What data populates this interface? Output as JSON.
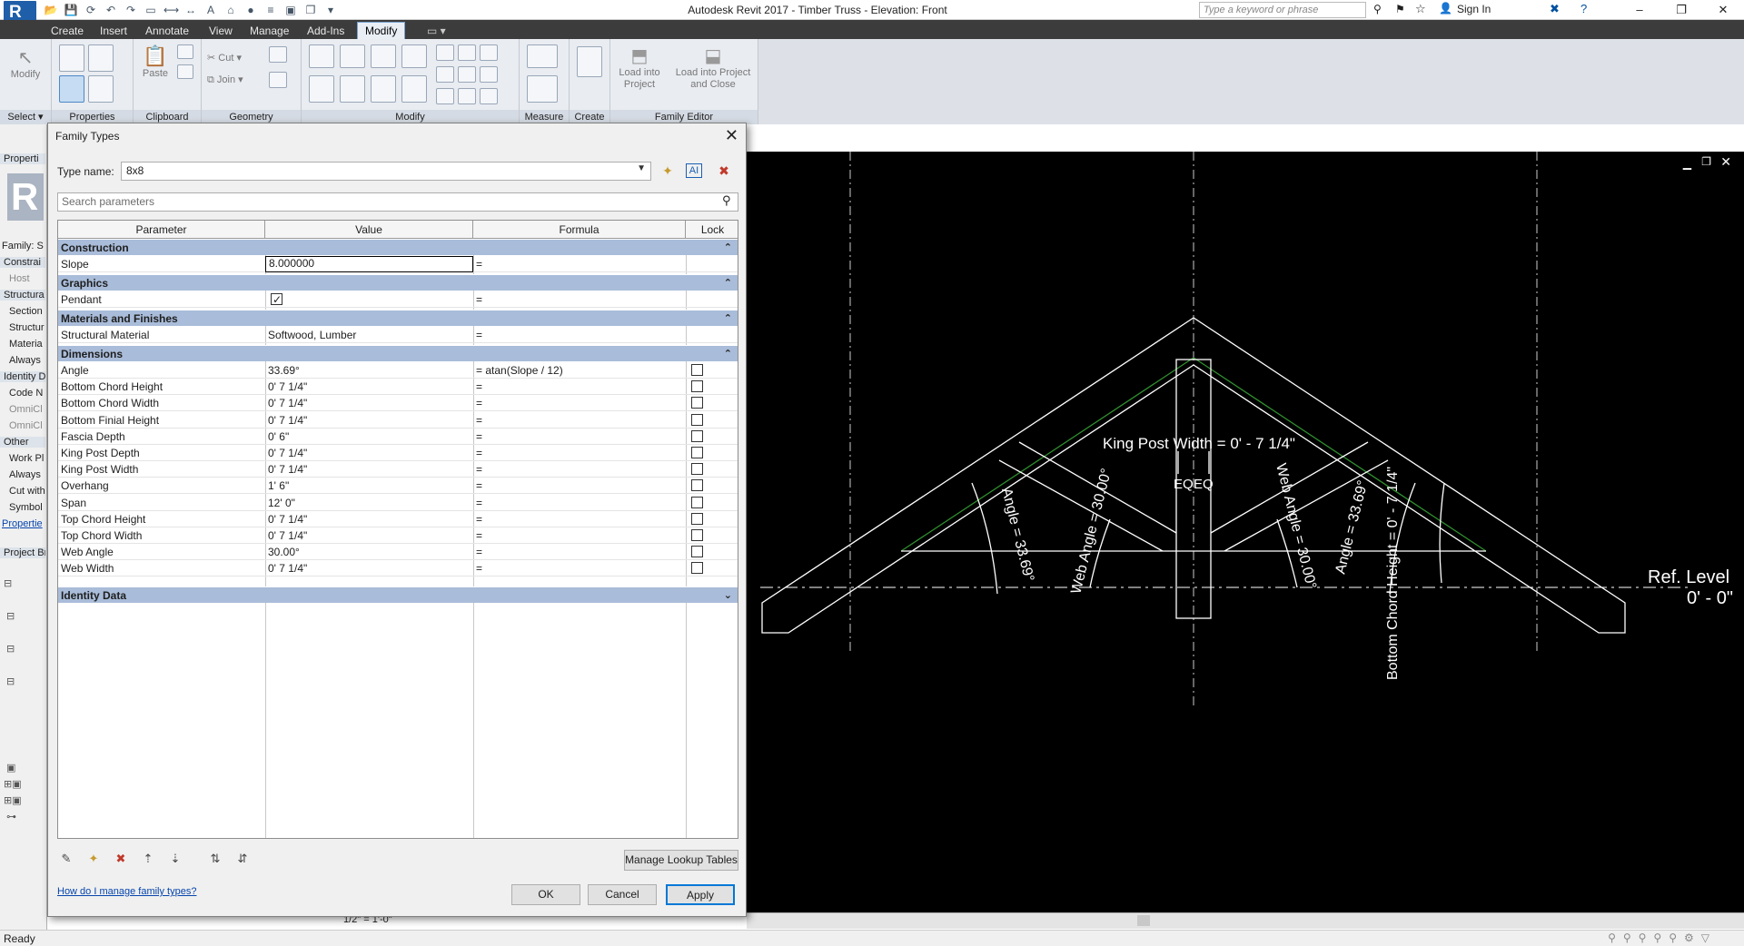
{
  "app": {
    "title": "Autodesk Revit 2017 -    Timber Truss - Elevation: Front",
    "logo_letter": "R",
    "search_placeholder": "Type a keyword or phrase",
    "sign_in": "Sign In",
    "window_controls": [
      "–",
      "❐",
      "✕"
    ]
  },
  "ribbon": {
    "tabs": [
      "Create",
      "Insert",
      "Annotate",
      "View",
      "Manage",
      "Add-Ins",
      "Modify"
    ],
    "active_tab": "Modify",
    "groups": {
      "select": "Select",
      "properties": "Properties",
      "clipboard": "Clipboard",
      "geometry": "Geometry",
      "modify": "Modify",
      "measure": "Measure",
      "create": "Create",
      "family_editor": "Family Editor"
    },
    "buttons": {
      "modify": "Modify",
      "paste": "Paste",
      "cut": "Cut",
      "join": "Join",
      "load_into_project": "Load into Project",
      "load_into_project_close": "Load into Project and Close"
    }
  },
  "left_panel": {
    "items": [
      "Properti",
      "Family: S",
      "Constrai",
      "Host",
      "Structura",
      "Section",
      "Structur",
      "Materia",
      "Always",
      "Identity D",
      "Code N",
      "OmniCl",
      "OmniCl",
      "Other",
      "Work Pl",
      "Always",
      "Cut with",
      "Symbol",
      "Propertie",
      "Project Br"
    ]
  },
  "dialog": {
    "title": "Family Types",
    "type_name_label": "Type name:",
    "type_name_value": "8x8",
    "search_placeholder": "Search parameters",
    "columns": [
      "Parameter",
      "Value",
      "Formula",
      "Lock"
    ],
    "groups": [
      {
        "name": "Construction",
        "rows": [
          {
            "param": "Slope",
            "value": "8.000000",
            "formula": "=",
            "lock": null
          }
        ]
      },
      {
        "name": "Graphics",
        "rows": [
          {
            "param": "Pendant",
            "value": "",
            "checkbox": true,
            "formula": "=",
            "lock": null
          }
        ]
      },
      {
        "name": "Materials and Finishes",
        "rows": [
          {
            "param": "Structural Material",
            "value": "Softwood, Lumber",
            "formula": "=",
            "lock": null
          }
        ]
      },
      {
        "name": "Dimensions",
        "rows": [
          {
            "param": "Angle",
            "value": "33.69°",
            "formula": "= atan(Slope / 12)",
            "lock": false
          },
          {
            "param": "Bottom Chord Height",
            "value": "0'  7 1/4\"",
            "formula": "=",
            "lock": false
          },
          {
            "param": "Bottom Chord Width",
            "value": "0'  7 1/4\"",
            "formula": "=",
            "lock": false
          },
          {
            "param": "Bottom Finial Height",
            "value": "0'  7 1/4\"",
            "formula": "=",
            "lock": false
          },
          {
            "param": "Fascia Depth",
            "value": "0'  6\"",
            "formula": "=",
            "lock": false
          },
          {
            "param": "King Post Depth",
            "value": "0'  7 1/4\"",
            "formula": "=",
            "lock": false
          },
          {
            "param": "King Post Width",
            "value": "0'  7 1/4\"",
            "formula": "=",
            "lock": false
          },
          {
            "param": "Overhang",
            "value": "1'  6\"",
            "formula": "=",
            "lock": false
          },
          {
            "param": "Span",
            "value": "12'  0\"",
            "formula": "=",
            "lock": false
          },
          {
            "param": "Top Chord Height",
            "value": "0'  7 1/4\"",
            "formula": "=",
            "lock": false
          },
          {
            "param": "Top Chord Width",
            "value": "0'  7 1/4\"",
            "formula": "=",
            "lock": false
          },
          {
            "param": "Web Angle",
            "value": "30.00°",
            "formula": "=",
            "lock": false
          },
          {
            "param": "Web Width",
            "value": "0'  7 1/4\"",
            "formula": "=",
            "lock": false
          }
        ]
      },
      {
        "name": "Identity Data",
        "rows": []
      }
    ],
    "manage_lookup": "Manage Lookup Tables",
    "help_link": "How do I manage family types?",
    "ok": "OK",
    "cancel": "Cancel",
    "apply": "Apply"
  },
  "drawing": {
    "king_post_width": "King Post Width = 0' - 7 1/4\"",
    "eq": "EQ",
    "angle_left": "Angle = 33.69°",
    "web_angle_left": "Web Angle = 30.00°",
    "web_angle_right": "Web Angle = 30.00°",
    "angle_right": "Angle = 33.69°",
    "bottom_chord_height": "Bottom Chord Height = 0' - 7 1/4\"",
    "ref_level": "Ref. Level",
    "ref_level_elev": "0' - 0\""
  },
  "view_bar": {
    "scale": "1/2\" = 1'-0\""
  },
  "status": {
    "text": "Ready"
  },
  "colors": {
    "accent": "#0078d7",
    "group_header": "#a9bcd9",
    "canvas": "#000000"
  }
}
